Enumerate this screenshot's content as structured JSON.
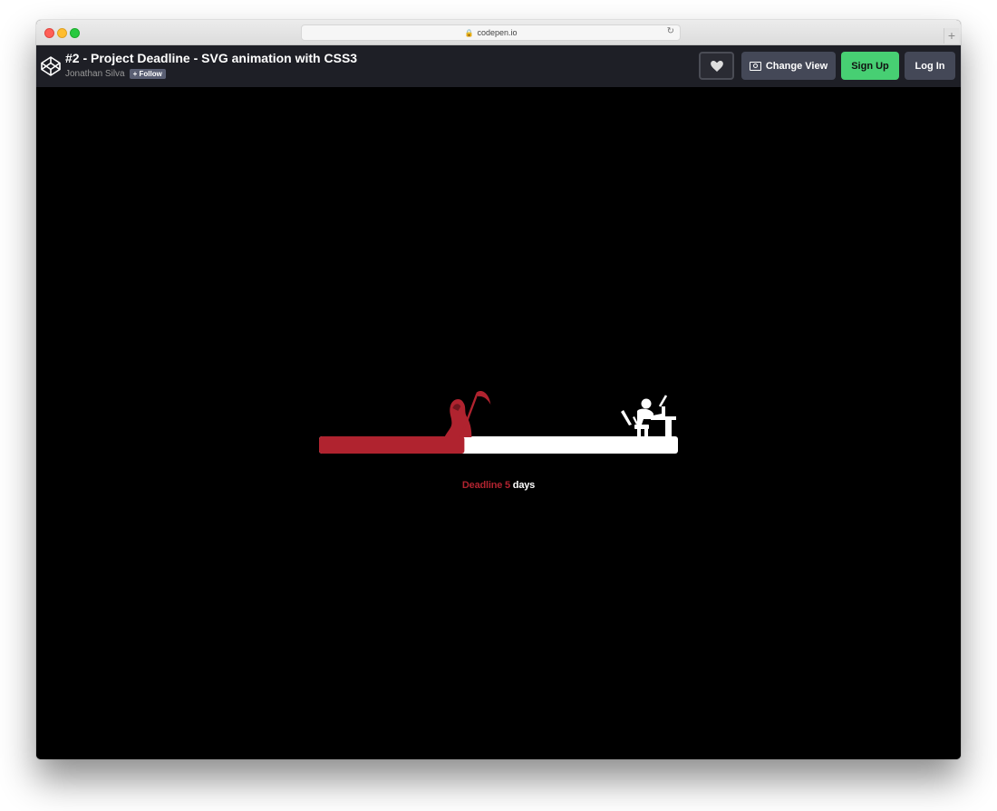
{
  "browser": {
    "url": "codepen.io"
  },
  "header": {
    "title": "#2 - Project Deadline - SVG animation with CSS3",
    "author": "Jonathan Silva",
    "follow_label": "+ Follow",
    "change_view_label": "Change View",
    "signup_label": "Sign Up",
    "login_label": "Log In"
  },
  "deadline": {
    "label": "Deadline",
    "days_number": "5",
    "days_unit": "days",
    "progress": 0.405
  },
  "colors": {
    "accent_red": "#b0232f",
    "signup_green": "#47cf73",
    "header_bg": "#1e1f26"
  }
}
